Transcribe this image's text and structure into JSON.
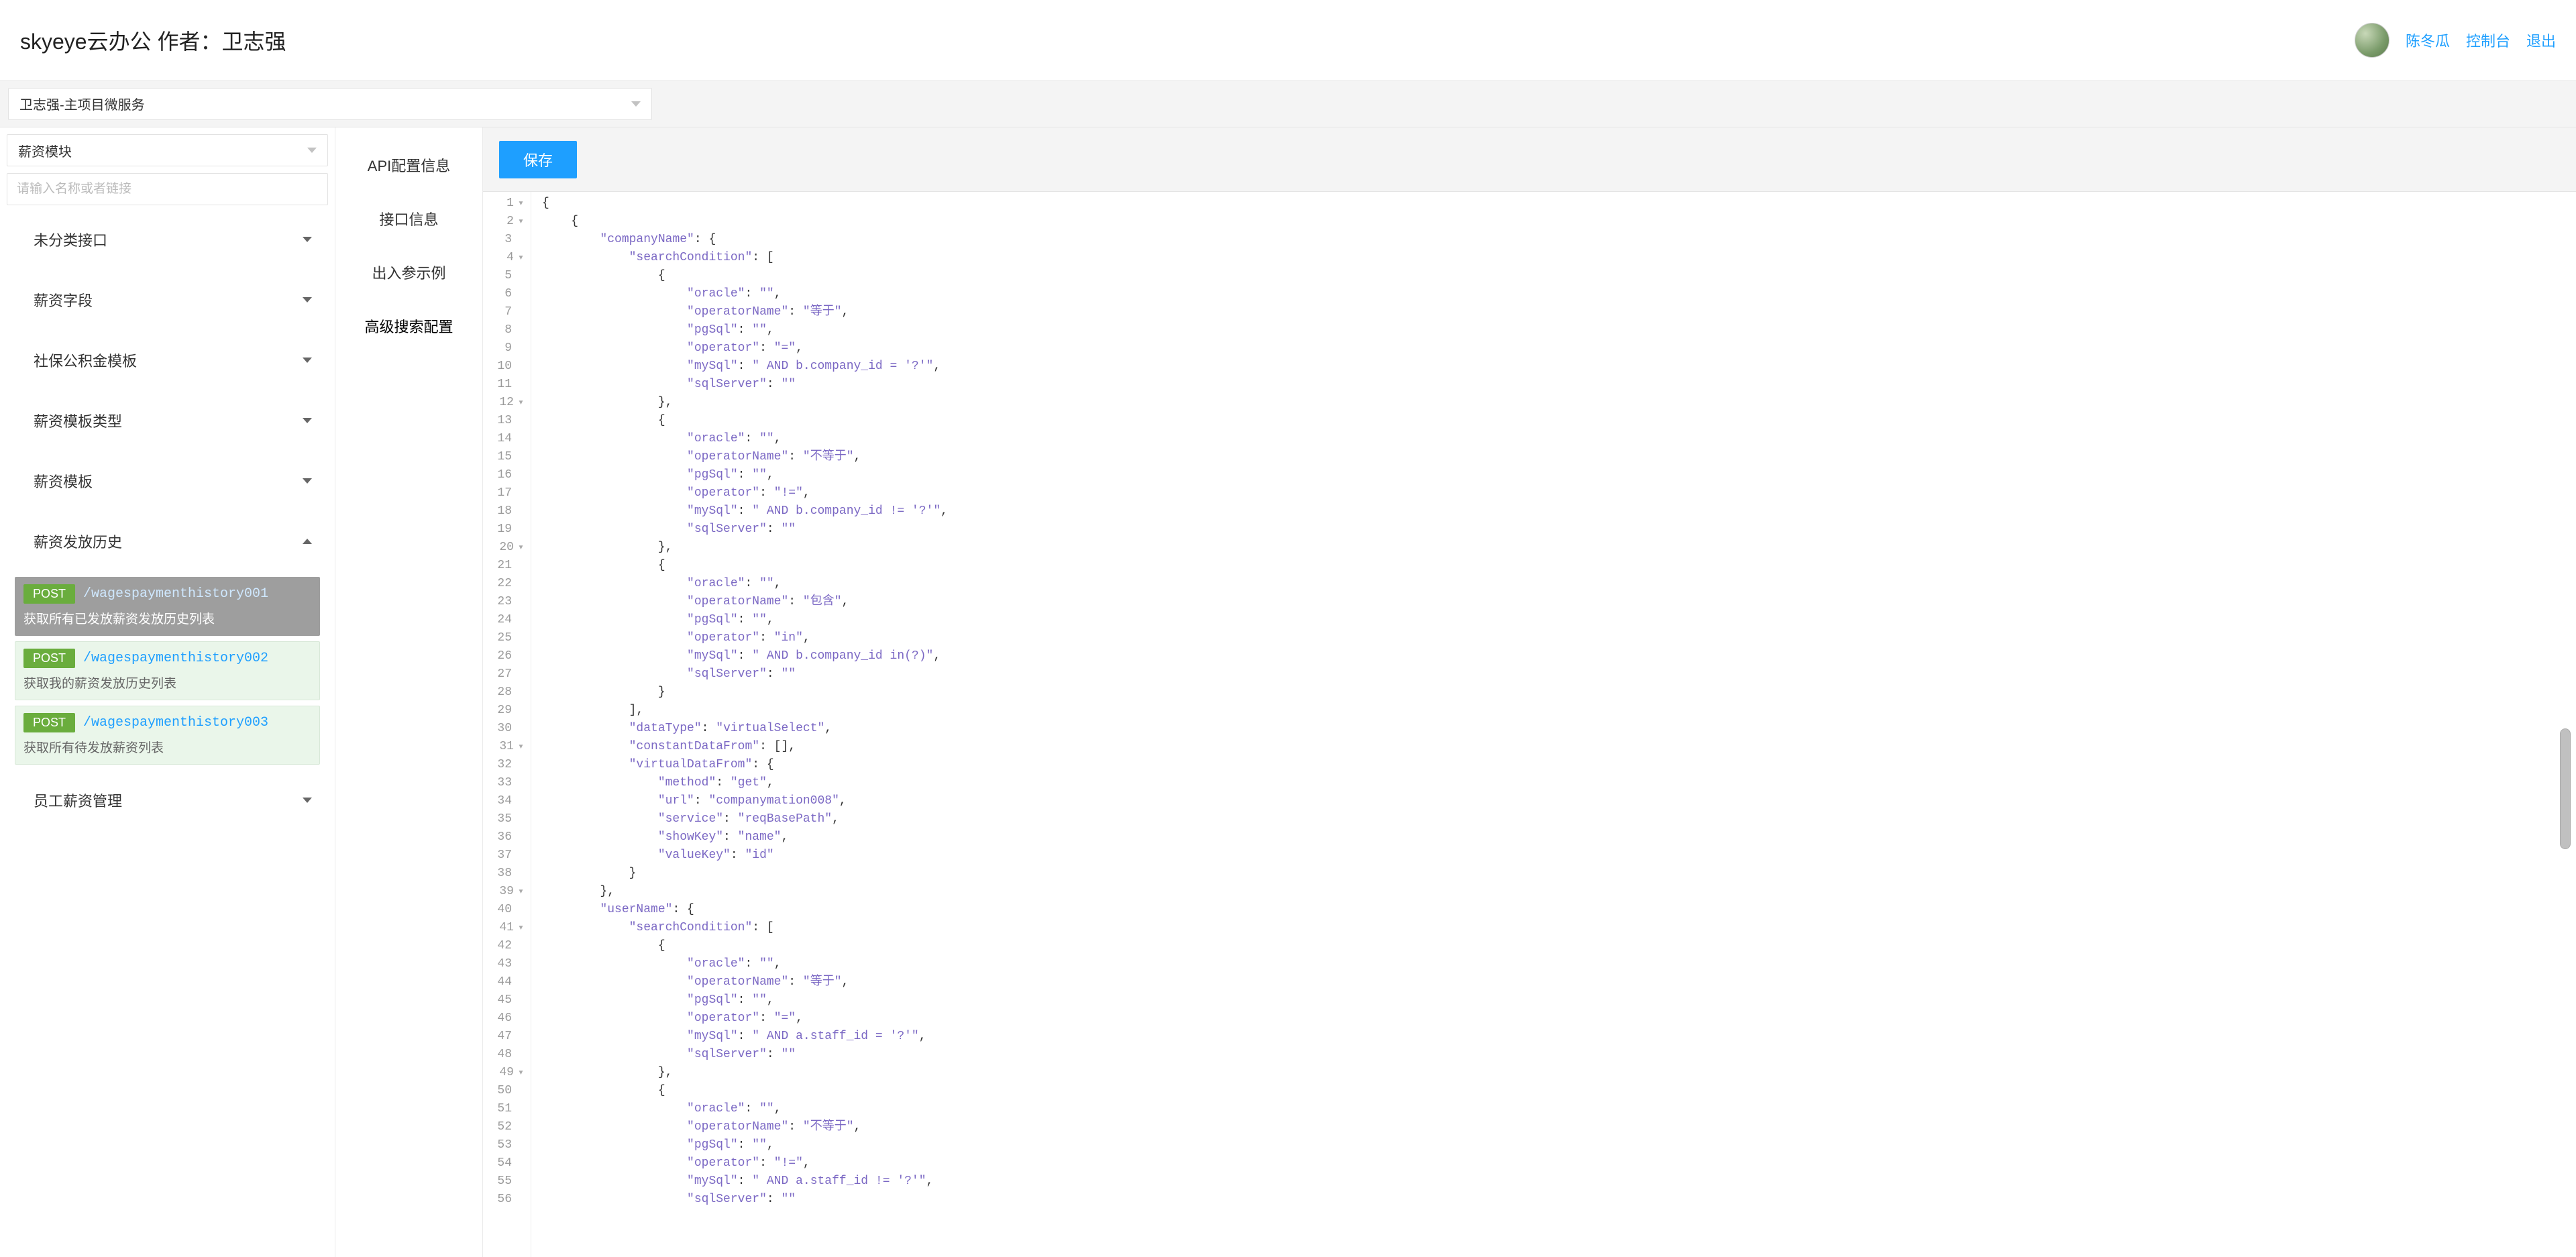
{
  "header": {
    "title": "skyeye云办公 作者：卫志强",
    "user": "陈冬瓜",
    "links": {
      "console": "控制台",
      "logout": "退出"
    }
  },
  "toolbar": {
    "project_select": "卫志强-主项目微服务"
  },
  "sidebar": {
    "module_select": "薪资模块",
    "search_placeholder": "请输入名称或者链接",
    "tree": [
      {
        "label": "未分类接口",
        "expanded": false
      },
      {
        "label": "薪资字段",
        "expanded": false
      },
      {
        "label": "社保公积金模板",
        "expanded": false
      },
      {
        "label": "薪资模板类型",
        "expanded": false
      },
      {
        "label": "薪资模板",
        "expanded": false
      },
      {
        "label": "薪资发放历史",
        "expanded": true,
        "children": [
          {
            "method": "POST",
            "path": "/wagespaymenthistory001",
            "desc": "获取所有已发放薪资发放历史列表",
            "active": true
          },
          {
            "method": "POST",
            "path": "/wagespaymenthistory002",
            "desc": "获取我的薪资发放历史列表",
            "active": false
          },
          {
            "method": "POST",
            "path": "/wagespaymenthistory003",
            "desc": "获取所有待发放薪资列表",
            "active": false
          }
        ]
      },
      {
        "label": "员工薪资管理",
        "expanded": false
      }
    ]
  },
  "mid_tabs": [
    {
      "label": "API配置信息",
      "key": "api-config",
      "active": false
    },
    {
      "label": "接口信息",
      "key": "interface-info",
      "active": false
    },
    {
      "label": "出入参示例",
      "key": "params-example",
      "active": false
    },
    {
      "label": "高级搜索配置",
      "key": "advanced-search",
      "active": true
    }
  ],
  "main": {
    "save_label": "保存"
  },
  "editor": {
    "fold_lines": [
      1,
      2,
      4,
      12,
      20,
      31,
      39,
      41,
      49
    ],
    "last_line": 56,
    "json_value": {
      "companyName": {
        "searchCondition": [
          {
            "oracle": "",
            "operatorName": "等于",
            "pgSql": "",
            "operator": "=",
            "mySql": " AND b.company_id = '?'",
            "sqlServer": ""
          },
          {
            "oracle": "",
            "operatorName": "不等于",
            "pgSql": "",
            "operator": "!=",
            "mySql": " AND b.company_id != '?'",
            "sqlServer": ""
          },
          {
            "oracle": "",
            "operatorName": "包含",
            "pgSql": "",
            "operator": "in",
            "mySql": " AND b.company_id in(?)",
            "sqlServer": ""
          }
        ],
        "dataType": "virtualSelect",
        "constantDataFrom": [],
        "virtualDataFrom": {
          "method": "get",
          "url": "companymation008",
          "service": "reqBasePath",
          "showKey": "name",
          "valueKey": "id"
        }
      },
      "userName": {
        "searchCondition": [
          {
            "oracle": "",
            "operatorName": "等于",
            "pgSql": "",
            "operator": "=",
            "mySql": " AND a.staff_id = '?'",
            "sqlServer": ""
          },
          {
            "oracle": "",
            "operatorName": "不等于",
            "pgSql": "",
            "operator": "!=",
            "mySql": " AND a.staff_id != '?'",
            "sqlServer": ""
          }
        ]
      }
    }
  }
}
